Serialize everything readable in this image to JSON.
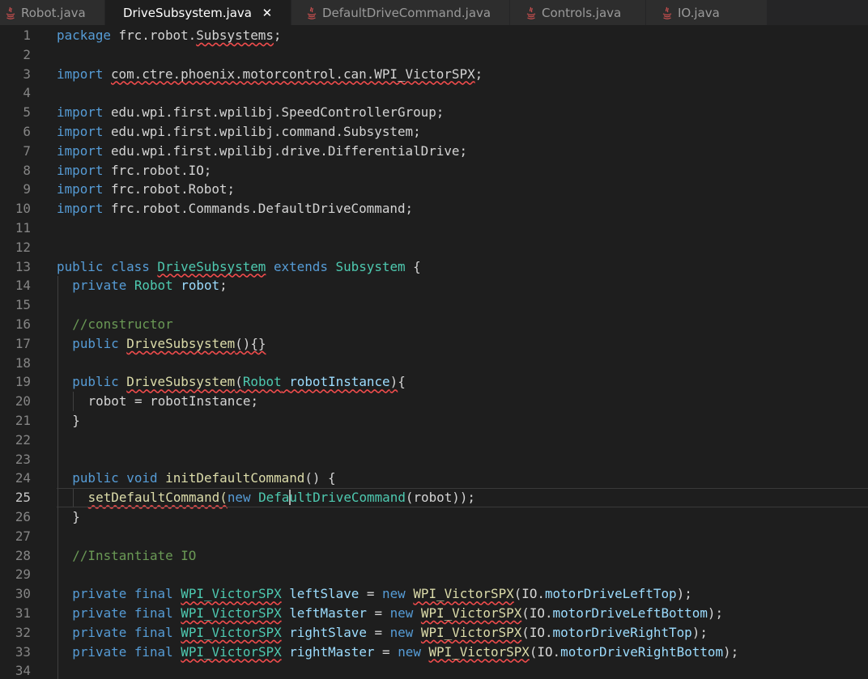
{
  "tabs": [
    {
      "label": "Robot.java",
      "active": false
    },
    {
      "label": "DriveSubsystem.java",
      "active": true
    },
    {
      "label": "DefaultDriveCommand.java",
      "active": false
    },
    {
      "label": "Controls.java",
      "active": false
    },
    {
      "label": "IO.java",
      "active": false
    }
  ],
  "close_glyph": "✕",
  "icons": {
    "tab_file": "java-file-icon",
    "close": "close-icon"
  },
  "colors": {
    "java_icon": "#c94f4f",
    "error_underline": "#f14c4c"
  },
  "editor": {
    "current_line": 25,
    "lines": [
      {
        "n": "1",
        "indent": 0,
        "tokens": [
          {
            "t": "package",
            "c": "kw"
          },
          {
            "t": " frc.robot."
          },
          {
            "t": "Subsystems",
            "err": true
          },
          {
            "t": ";"
          }
        ]
      },
      {
        "n": "2",
        "indent": 0,
        "tokens": []
      },
      {
        "n": "3",
        "indent": 0,
        "tokens": [
          {
            "t": "import",
            "c": "kw"
          },
          {
            "t": " "
          },
          {
            "t": "com.ctre.phoenix.motorcontrol.can.WPI_VictorSPX",
            "err": true
          },
          {
            "t": ";"
          }
        ]
      },
      {
        "n": "4",
        "indent": 0,
        "tokens": []
      },
      {
        "n": "5",
        "indent": 0,
        "tokens": [
          {
            "t": "import",
            "c": "kw"
          },
          {
            "t": " edu.wpi.first.wpilibj.SpeedControllerGroup;"
          }
        ]
      },
      {
        "n": "6",
        "indent": 0,
        "tokens": [
          {
            "t": "import",
            "c": "kw"
          },
          {
            "t": " edu.wpi.first.wpilibj.command.Subsystem;"
          }
        ]
      },
      {
        "n": "7",
        "indent": 0,
        "tokens": [
          {
            "t": "import",
            "c": "kw"
          },
          {
            "t": " edu.wpi.first.wpilibj.drive.DifferentialDrive;"
          }
        ]
      },
      {
        "n": "8",
        "indent": 0,
        "tokens": [
          {
            "t": "import",
            "c": "kw"
          },
          {
            "t": " frc.robot.IO;"
          }
        ]
      },
      {
        "n": "9",
        "indent": 0,
        "tokens": [
          {
            "t": "import",
            "c": "kw"
          },
          {
            "t": " frc.robot.Robot;"
          }
        ]
      },
      {
        "n": "10",
        "indent": 0,
        "tokens": [
          {
            "t": "import",
            "c": "kw"
          },
          {
            "t": " frc.robot.Commands.DefaultDriveCommand;"
          }
        ]
      },
      {
        "n": "11",
        "indent": 0,
        "tokens": []
      },
      {
        "n": "12",
        "indent": 0,
        "tokens": []
      },
      {
        "n": "13",
        "indent": 0,
        "tokens": [
          {
            "t": "public",
            "c": "kw"
          },
          {
            "t": " "
          },
          {
            "t": "class",
            "c": "kw"
          },
          {
            "t": " "
          },
          {
            "t": "DriveSubsystem",
            "c": "ty",
            "err": true
          },
          {
            "t": " "
          },
          {
            "t": "extends",
            "c": "kw"
          },
          {
            "t": " "
          },
          {
            "t": "Subsystem",
            "c": "ty"
          },
          {
            "t": " {"
          }
        ]
      },
      {
        "n": "14",
        "indent": 1,
        "tokens": [
          {
            "t": "private",
            "c": "kw"
          },
          {
            "t": " "
          },
          {
            "t": "Robot",
            "c": "ty"
          },
          {
            "t": " "
          },
          {
            "t": "robot",
            "c": "va"
          },
          {
            "t": ";"
          }
        ]
      },
      {
        "n": "15",
        "indent": 1,
        "tokens": []
      },
      {
        "n": "16",
        "indent": 1,
        "tokens": [
          {
            "t": "//constructor",
            "c": "cm"
          }
        ]
      },
      {
        "n": "17",
        "indent": 1,
        "tokens": [
          {
            "t": "public",
            "c": "kw"
          },
          {
            "t": " "
          },
          {
            "t": "DriveSubsystem",
            "c": "fn",
            "err": true
          },
          {
            "t": "(){}",
            "err": true
          }
        ]
      },
      {
        "n": "18",
        "indent": 1,
        "tokens": []
      },
      {
        "n": "19",
        "indent": 1,
        "tokens": [
          {
            "t": "public",
            "c": "kw"
          },
          {
            "t": " "
          },
          {
            "t": "DriveSubsystem",
            "c": "fn",
            "err": true
          },
          {
            "t": "(",
            "err": true
          },
          {
            "t": "Robot",
            "c": "ty",
            "err": true
          },
          {
            "t": " ",
            "err": true
          },
          {
            "t": "robotInstance",
            "c": "va",
            "err": true
          },
          {
            "t": ")",
            "err": true
          },
          {
            "t": "{"
          }
        ]
      },
      {
        "n": "20",
        "indent": 2,
        "tokens": [
          {
            "t": "robot = robotInstance;"
          }
        ]
      },
      {
        "n": "21",
        "indent": 1,
        "tokens": [
          {
            "t": "}"
          }
        ]
      },
      {
        "n": "22",
        "indent": 1,
        "tokens": []
      },
      {
        "n": "23",
        "indent": 1,
        "tokens": []
      },
      {
        "n": "24",
        "indent": 1,
        "tokens": [
          {
            "t": "public",
            "c": "kw"
          },
          {
            "t": " "
          },
          {
            "t": "void",
            "c": "kw"
          },
          {
            "t": " "
          },
          {
            "t": "initDefaultCommand",
            "c": "fn"
          },
          {
            "t": "() {"
          }
        ]
      },
      {
        "n": "25",
        "indent": 2,
        "tokens": [
          {
            "t": "setDefaultCommand(",
            "c": "fn",
            "err": true
          },
          {
            "t": "new",
            "c": "kw"
          },
          {
            "t": " "
          },
          {
            "t": "Defa",
            "c": "ty"
          },
          {
            "cursor": true
          },
          {
            "t": "ultDriveCommand",
            "c": "ty"
          },
          {
            "t": "(robot));"
          }
        ]
      },
      {
        "n": "26",
        "indent": 1,
        "tokens": [
          {
            "t": "}"
          }
        ]
      },
      {
        "n": "27",
        "indent": 1,
        "tokens": []
      },
      {
        "n": "28",
        "indent": 1,
        "tokens": [
          {
            "t": "//Instantiate IO",
            "c": "cm"
          }
        ]
      },
      {
        "n": "29",
        "indent": 1,
        "tokens": []
      },
      {
        "n": "30",
        "indent": 1,
        "tokens": [
          {
            "t": "private",
            "c": "kw"
          },
          {
            "t": " "
          },
          {
            "t": "final",
            "c": "kw"
          },
          {
            "t": " "
          },
          {
            "t": "WPI_VictorSPX",
            "c": "ty",
            "err": true
          },
          {
            "t": " "
          },
          {
            "t": "leftSlave",
            "c": "va"
          },
          {
            "t": " = "
          },
          {
            "t": "new",
            "c": "kw"
          },
          {
            "t": " "
          },
          {
            "t": "WPI_VictorSPX",
            "c": "fn",
            "err": true
          },
          {
            "t": "(IO."
          },
          {
            "t": "motorDriveLeftTop",
            "c": "va"
          },
          {
            "t": ");"
          }
        ]
      },
      {
        "n": "31",
        "indent": 1,
        "tokens": [
          {
            "t": "private",
            "c": "kw"
          },
          {
            "t": " "
          },
          {
            "t": "final",
            "c": "kw"
          },
          {
            "t": " "
          },
          {
            "t": "WPI_VictorSPX",
            "c": "ty",
            "err": true
          },
          {
            "t": " "
          },
          {
            "t": "leftMaster",
            "c": "va"
          },
          {
            "t": " = "
          },
          {
            "t": "new",
            "c": "kw"
          },
          {
            "t": " "
          },
          {
            "t": "WPI_VictorSPX",
            "c": "fn",
            "err": true
          },
          {
            "t": "(IO."
          },
          {
            "t": "motorDriveLeftBottom",
            "c": "va"
          },
          {
            "t": ");"
          }
        ]
      },
      {
        "n": "32",
        "indent": 1,
        "tokens": [
          {
            "t": "private",
            "c": "kw"
          },
          {
            "t": " "
          },
          {
            "t": "final",
            "c": "kw"
          },
          {
            "t": " "
          },
          {
            "t": "WPI_VictorSPX",
            "c": "ty",
            "err": true
          },
          {
            "t": " "
          },
          {
            "t": "rightSlave",
            "c": "va"
          },
          {
            "t": " = "
          },
          {
            "t": "new",
            "c": "kw"
          },
          {
            "t": " "
          },
          {
            "t": "WPI_VictorSPX",
            "c": "fn",
            "err": true
          },
          {
            "t": "(IO."
          },
          {
            "t": "motorDriveRightTop",
            "c": "va"
          },
          {
            "t": ");"
          }
        ]
      },
      {
        "n": "33",
        "indent": 1,
        "tokens": [
          {
            "t": "private",
            "c": "kw"
          },
          {
            "t": " "
          },
          {
            "t": "final",
            "c": "kw"
          },
          {
            "t": " "
          },
          {
            "t": "WPI_VictorSPX",
            "c": "ty",
            "err": true
          },
          {
            "t": " "
          },
          {
            "t": "rightMaster",
            "c": "va"
          },
          {
            "t": " = "
          },
          {
            "t": "new",
            "c": "kw"
          },
          {
            "t": " "
          },
          {
            "t": "WPI_VictorSPX",
            "c": "fn",
            "err": true
          },
          {
            "t": "(IO."
          },
          {
            "t": "motorDriveRightBottom",
            "c": "va"
          },
          {
            "t": ");"
          }
        ]
      },
      {
        "n": "34",
        "indent": 1,
        "tokens": []
      }
    ]
  }
}
